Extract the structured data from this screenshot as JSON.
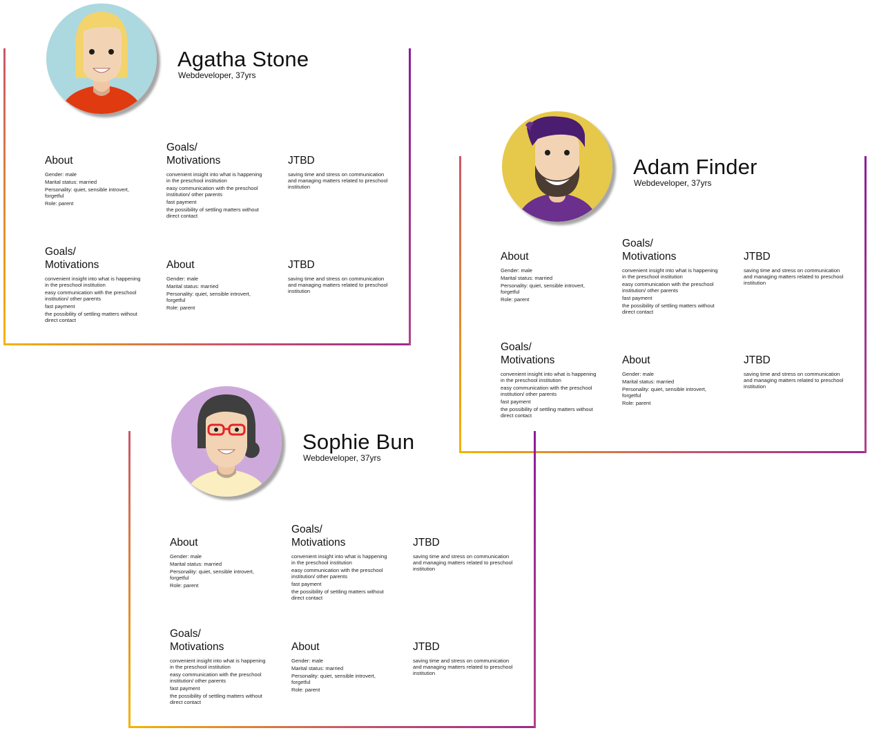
{
  "labels": {
    "about": "About",
    "goals_l1": "Goals/",
    "goals_l2": "Motivations",
    "jtbd": "JTBD"
  },
  "about": {
    "gender": "Gender: male",
    "marital": "Marital status: married",
    "personality": "Personality: quiet, sensible introvert, forgetful",
    "role": "Role: parent"
  },
  "goals": {
    "g1": "convenient insight into what is happening in the preschool institution",
    "g2": "easy communication with the preschool institution/ other parents",
    "g3": "fast payment",
    "g4": "the possibility of settling matters without direct contact"
  },
  "jtbd": {
    "text": "saving time and stress on communication and managing matters related to preschool institution"
  },
  "personas": [
    {
      "name": "Agatha Stone",
      "subtitle": "Webdeveloper, 37yrs",
      "avatar": "avatar-woman-blonde",
      "bg": "#acd8e0"
    },
    {
      "name": "Adam Finder",
      "subtitle": "Webdeveloper, 37yrs",
      "avatar": "avatar-man-bearded",
      "bg": "#e6c84a"
    },
    {
      "name": "Sophie Bun",
      "subtitle": "Webdeveloper, 37yrs",
      "avatar": "avatar-woman-glasses",
      "bg": "#ceaadc"
    }
  ],
  "colors": {
    "frame_start": "#f4b400",
    "frame_mid": "#c8566a",
    "frame_end": "#8e1a9a"
  }
}
